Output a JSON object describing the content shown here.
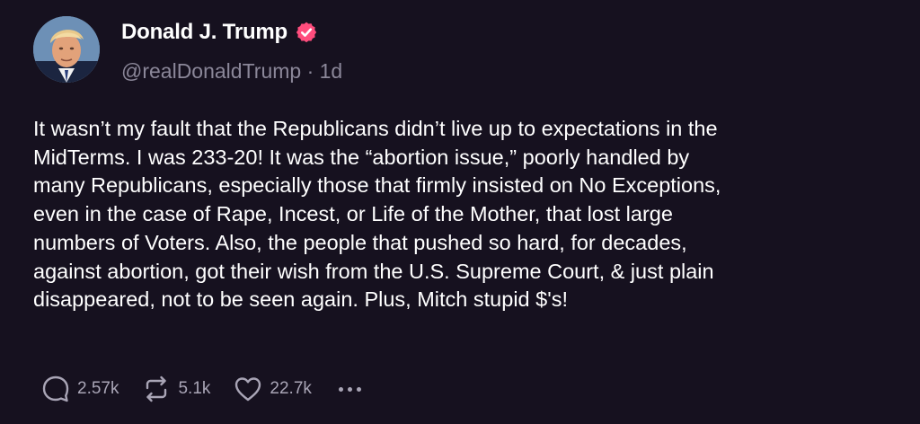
{
  "author": {
    "display_name": "Donald J. Trump",
    "handle": "@realDonaldTrump",
    "separator": "·",
    "time_ago": "1d",
    "avatar_icon": "profile-photo",
    "verified_icon": "verified-badge-icon",
    "verified_color": "#ff4d7d"
  },
  "post": {
    "lines": [
      "It wasn’t my fault that the Republicans didn’t live up to expectations in the",
      "MidTerms. I was 233-20! It was the “abortion issue,” poorly handled by",
      "many Republicans, especially those that firmly insisted on No Exceptions,",
      "even in the case of Rape, Incest, or Life of the Mother, that lost large",
      "numbers of Voters. Also, the people that pushed so hard, for decades,",
      "against abortion, got their wish from the U.S. Supreme Court, & just plain",
      "disappeared, not to be seen again. Plus, Mitch stupid $'s!"
    ]
  },
  "actions": {
    "reply": {
      "icon": "reply-icon",
      "count": "2.57k"
    },
    "repost": {
      "icon": "repost-icon",
      "count": "5.1k"
    },
    "like": {
      "icon": "heart-icon",
      "count": "22.7k"
    },
    "more": {
      "icon": "more-options-icon"
    }
  },
  "colors": {
    "background": "#16111f",
    "text_primary": "#ffffff",
    "text_secondary": "#8b8799",
    "icon_muted": "#a9a5b6"
  }
}
